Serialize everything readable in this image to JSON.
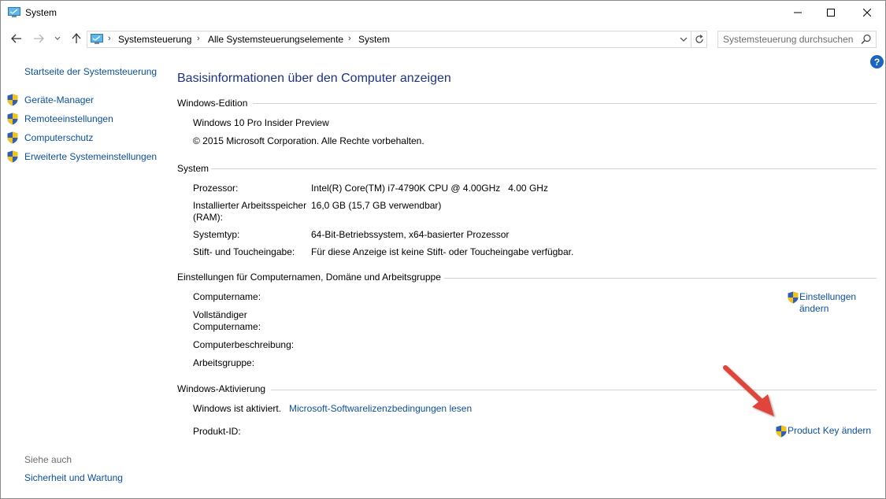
{
  "window": {
    "title": "System"
  },
  "address": {
    "crumbs": [
      "Systemsteuerung",
      "Alle Systemsteuerungselemente",
      "System"
    ],
    "search_placeholder": "Systemsteuerung durchsuchen",
    "help_glyph": "?"
  },
  "sidebar": {
    "home": "Startseite der Systemsteuerung",
    "items": [
      {
        "label": "Geräte-Manager",
        "icon": "shield-icon"
      },
      {
        "label": "Remoteeinstellungen",
        "icon": "shield-icon"
      },
      {
        "label": "Computerschutz",
        "icon": "shield-icon"
      },
      {
        "label": "Erweiterte Systemeinstellungen",
        "icon": "shield-icon"
      }
    ],
    "see_also_title": "Siehe auch",
    "see_also_link": "Sicherheit und Wartung"
  },
  "main": {
    "title": "Basisinformationen über den Computer anzeigen",
    "edition": {
      "heading": "Windows-Edition",
      "name": "Windows 10 Pro Insider Preview",
      "copyright": "© 2015 Microsoft Corporation. Alle Rechte vorbehalten."
    },
    "system": {
      "heading": "System",
      "rows": [
        {
          "label": "Prozessor:",
          "value": "Intel(R) Core(TM) i7-4790K CPU @ 4.00GHz   4.00 GHz"
        },
        {
          "label": "Installierter Arbeitsspeicher (RAM):",
          "value": "16,0 GB (15,7 GB verwendbar)"
        },
        {
          "label": "Systemtyp:",
          "value": "64-Bit-Betriebssystem, x64-basierter Prozessor"
        },
        {
          "label": "Stift- und Toucheingabe:",
          "value": "Für diese Anzeige ist keine Stift- oder Toucheingabe verfügbar."
        }
      ]
    },
    "computer": {
      "heading": "Einstellungen für Computernamen, Domäne und Arbeitsgruppe",
      "rows": [
        {
          "label": "Computername:",
          "value": ""
        },
        {
          "label": "Vollständiger Computername:",
          "value": ""
        },
        {
          "label": "Computerbeschreibung:",
          "value": ""
        },
        {
          "label": "Arbeitsgruppe:",
          "value": ""
        }
      ],
      "change_link": "Einstellungen ändern"
    },
    "activation": {
      "heading": "Windows-Aktivierung",
      "status": "Windows ist aktiviert.",
      "license_link": "Microsoft-Softwarelizenzbedingungen lesen",
      "product_id_label": "Produkt-ID:",
      "product_key_link": "Product Key ändern"
    }
  },
  "colors": {
    "link": "#0b4fa3",
    "title": "#1e3287",
    "annotation_arrow": "#e0453a"
  }
}
